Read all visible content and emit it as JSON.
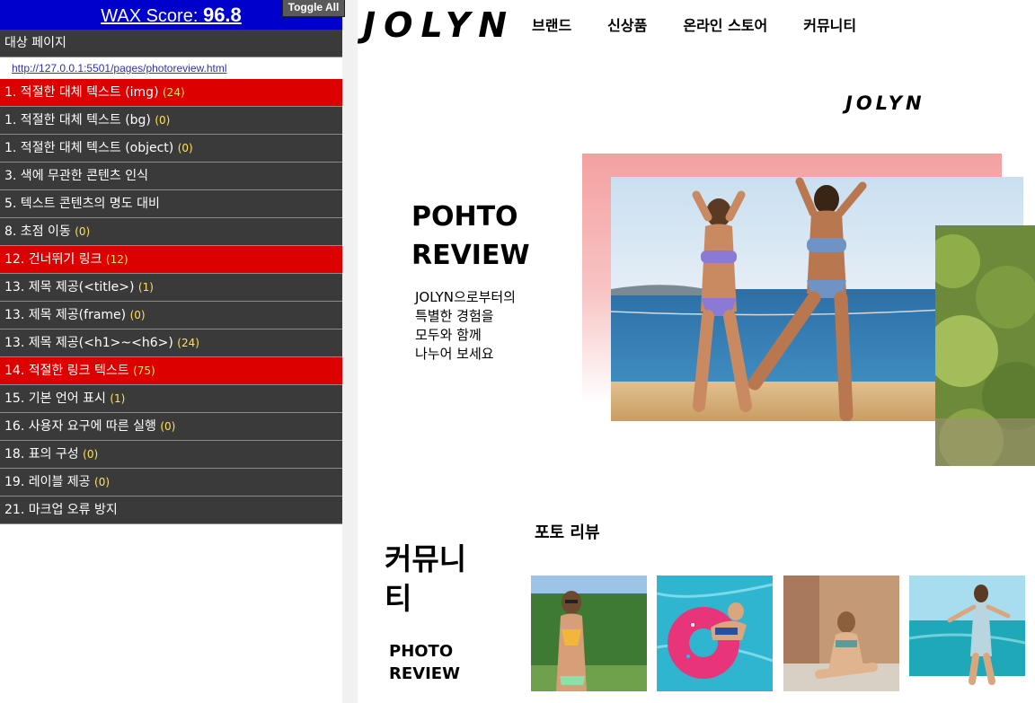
{
  "wax": {
    "score_label": "WAX Score: ",
    "score_value": "96.8",
    "toggle_label": "Toggle All",
    "target_heading": "대상 페이지",
    "target_url": "http://127.0.0.1:5501/pages/photoreview.html",
    "rows": [
      {
        "label": "1. 적절한 대체 텍스트 (img)",
        "count": "(24)",
        "status": "error"
      },
      {
        "label": "1. 적절한 대체 텍스트 (bg)",
        "count": "(0)",
        "status": "normal"
      },
      {
        "label": "1. 적절한 대체 텍스트 (object)",
        "count": "(0)",
        "status": "normal"
      },
      {
        "label": "3. 색에 무관한 콘텐츠 인식",
        "count": "",
        "status": "normal"
      },
      {
        "label": "5. 텍스트 콘텐츠의 명도 대비",
        "count": "",
        "status": "normal"
      },
      {
        "label": "8. 초점 이동",
        "count": "(0)",
        "status": "normal"
      },
      {
        "label": "12. 건너뛰기 링크",
        "count": "(12)",
        "status": "error"
      },
      {
        "label": "13. 제목 제공(<title>)",
        "count": "(1)",
        "status": "normal"
      },
      {
        "label": "13. 제목 제공(frame)",
        "count": "(0)",
        "status": "normal"
      },
      {
        "label": "13. 제목 제공(<h1>~<h6>)",
        "count": "(24)",
        "status": "normal"
      },
      {
        "label": "14. 적절한 링크 텍스트",
        "count": "(75)",
        "status": "error"
      },
      {
        "label": "15. 기본 언어 표시",
        "count": "(1)",
        "status": "normal"
      },
      {
        "label": "16. 사용자 요구에 따른 실행",
        "count": "(0)",
        "status": "normal"
      },
      {
        "label": "18. 표의 구성",
        "count": "(0)",
        "status": "normal"
      },
      {
        "label": "19. 레이블 제공",
        "count": "(0)",
        "status": "normal"
      },
      {
        "label": "21. 마크업 오류 방지",
        "count": "",
        "status": "normal"
      }
    ],
    "colors": {
      "header": "#0000cc",
      "row": "#3a3a3a",
      "error": "#dd0000",
      "count": "#ffe25a"
    }
  },
  "site": {
    "logo": "JOLYN",
    "nav": [
      "브랜드",
      "신상품",
      "온라인 스토어",
      "커뮤니티"
    ],
    "hero_logo": "JOLYN",
    "hero_title": [
      "POHTO",
      "REVIEW"
    ],
    "hero_desc": [
      "JOLYN으로부터의",
      "특별한 경험을",
      "모두와 함께",
      "나누어 보세요"
    ],
    "community_title": [
      "커뮤니",
      "티"
    ],
    "community_link": [
      "PHOTO",
      "REVIEW"
    ],
    "photo_review_heading": "포토 리뷰",
    "thumbnails": [
      "photo-swimwear-sunglasses",
      "photo-donut-float-pool",
      "photo-swimwear-seated",
      "photo-surf-sea"
    ]
  }
}
